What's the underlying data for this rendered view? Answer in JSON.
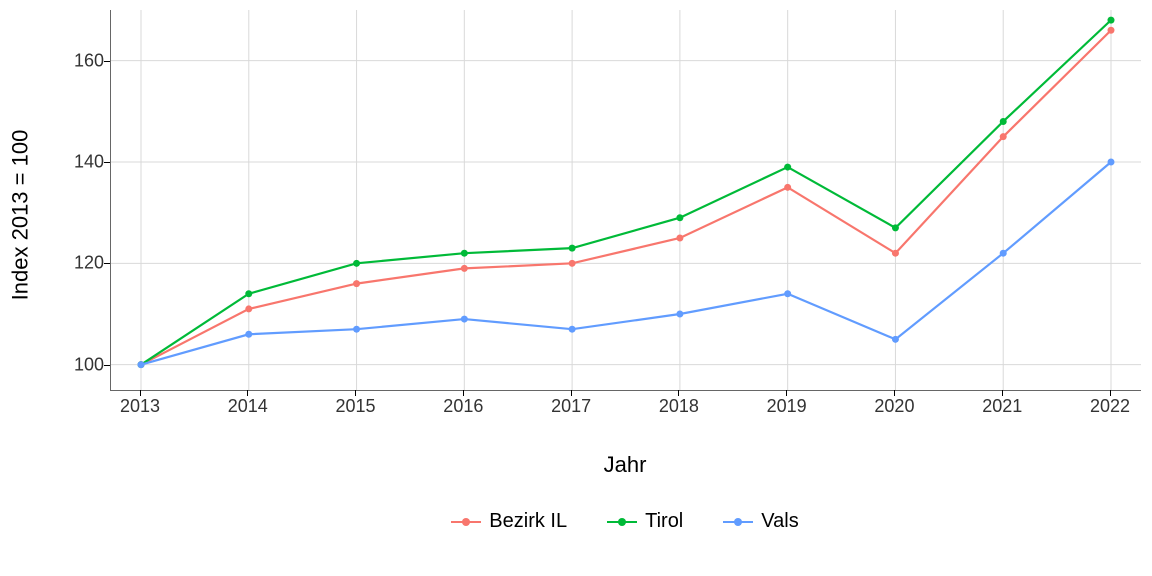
{
  "chart_data": {
    "type": "line",
    "title": "",
    "xlabel": "Jahr",
    "ylabel": "Index  2013  = 100",
    "categories": [
      "2013",
      "2014",
      "2015",
      "2016",
      "2017",
      "2018",
      "2019",
      "2020",
      "2021",
      "2022"
    ],
    "y_ticks": [
      100,
      120,
      140,
      160
    ],
    "ylim": [
      95,
      170
    ],
    "series": [
      {
        "name": "Bezirk IL",
        "color": "#F8766D",
        "values": [
          100,
          111,
          116,
          119,
          120,
          125,
          135,
          122,
          145,
          166
        ]
      },
      {
        "name": "Tirol",
        "color": "#00BA38",
        "values": [
          100,
          114,
          120,
          122,
          123,
          129,
          139,
          127,
          148,
          168
        ]
      },
      {
        "name": "Vals",
        "color": "#619CFF",
        "values": [
          100,
          106,
          107,
          109,
          107,
          110,
          114,
          105,
          122,
          140
        ]
      }
    ],
    "legend_position": "bottom",
    "grid": true
  }
}
